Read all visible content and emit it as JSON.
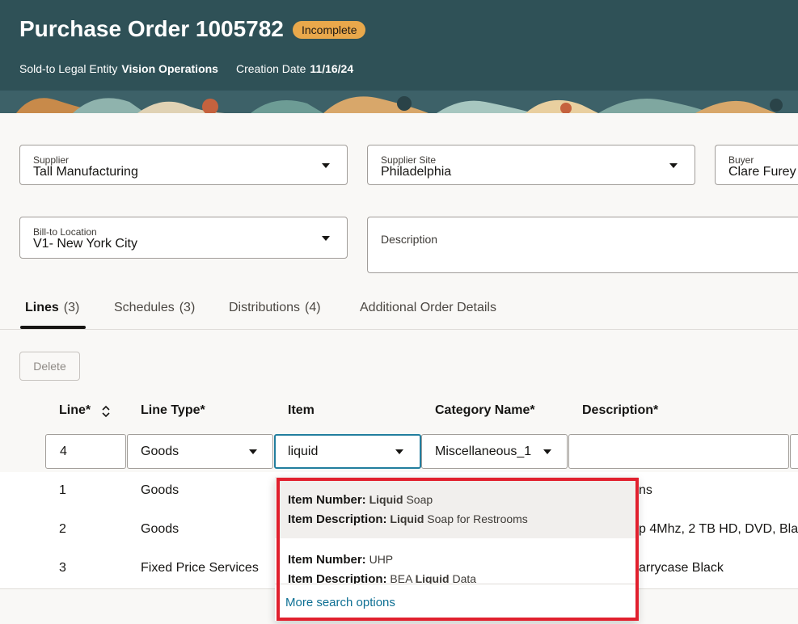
{
  "header": {
    "title": "Purchase Order 1005782",
    "status": "Incomplete",
    "legal_entity_label": "Sold-to Legal Entity",
    "legal_entity_value": "Vision Operations",
    "creation_date_label": "Creation Date",
    "creation_date_value": "11/16/24"
  },
  "form": {
    "supplier_label": "Supplier",
    "supplier_value": "Tall Manufacturing",
    "supplier_site_label": "Supplier Site",
    "supplier_site_value": "Philadelphia",
    "buyer_label": "Buyer",
    "buyer_value": "Clare Furey",
    "bill_to_label": "Bill-to Location",
    "bill_to_value": "V1- New York City",
    "description_label": "Description"
  },
  "tabs": [
    {
      "label": "Lines",
      "count": "(3)"
    },
    {
      "label": "Schedules",
      "count": "(3)"
    },
    {
      "label": "Distributions",
      "count": "(4)"
    },
    {
      "label": "Additional Order Details",
      "count": ""
    }
  ],
  "toolbar": {
    "delete_label": "Delete"
  },
  "table": {
    "headers": [
      "Line*",
      "Line Type*",
      "Item",
      "Category Name*",
      "Description*"
    ],
    "edit_row": {
      "line": "4",
      "line_type": "Goods",
      "item": "liquid",
      "category": "Miscellaneous_1"
    },
    "rows": [
      {
        "line": "1",
        "line_type": "Goods",
        "description": "ns"
      },
      {
        "line": "2",
        "line_type": "Goods",
        "description": "p 4Mhz, 2 TB HD, DVD, Bla"
      },
      {
        "line": "3",
        "line_type": "Fixed Price Services",
        "description": "arrycase Black"
      }
    ]
  },
  "item_dropdown": {
    "results": [
      {
        "number_label": "Item Number:",
        "number_match": "Liquid",
        "number_rest": " Soap",
        "desc_label": "Item Description:",
        "desc_match": "Liquid",
        "desc_rest": " Soap for Restrooms"
      },
      {
        "number_label": "Item Number:",
        "number_match": "",
        "number_rest": " UHP",
        "desc_label": "Item Description:",
        "desc_pre": " BEA ",
        "desc_match": "Liquid",
        "desc_rest": " Data"
      }
    ],
    "more_link": "More search options"
  },
  "colors": {
    "header_bg": "#2f5157",
    "badge": "#e9a84b",
    "focus": "#227e9e",
    "highlight": "#e1202e",
    "link": "#0d6f93"
  }
}
